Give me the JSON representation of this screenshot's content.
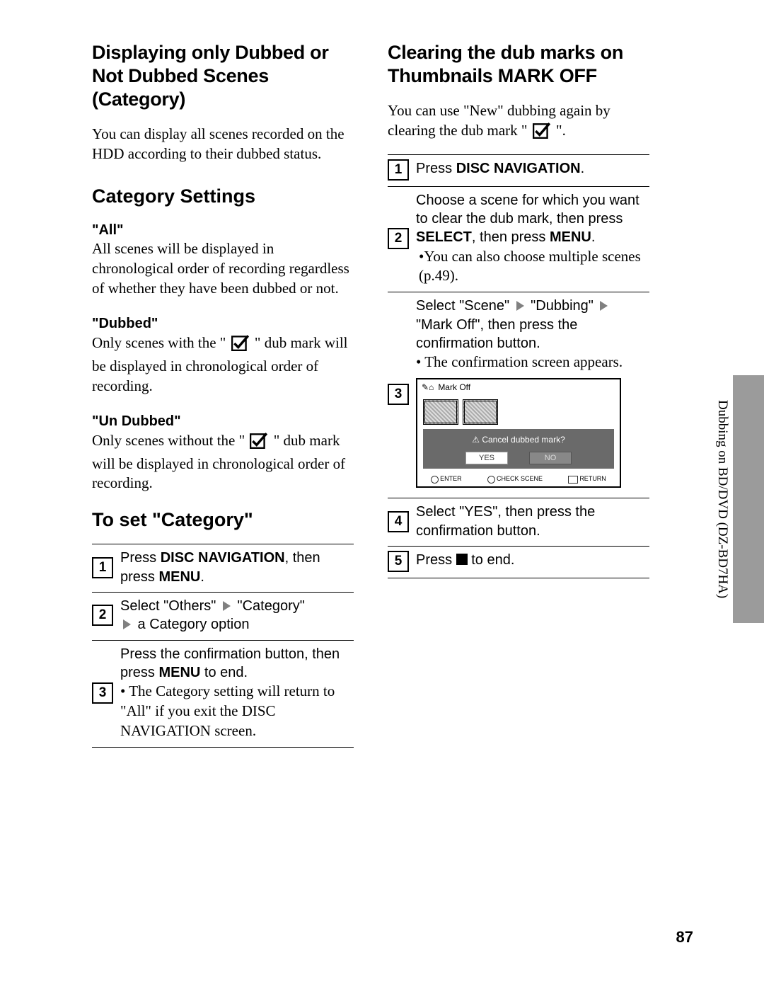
{
  "left": {
    "title": "Displaying only Dubbed or Not Dubbed Scenes (Category)",
    "intro": "You can display all scenes recorded on the HDD according to their dubbed status.",
    "h_category": "Category Settings",
    "cat_all_label": "\"All\"",
    "cat_all_body": "All scenes will be displayed in chronological order of recording regardless of whether they have been dubbed or not.",
    "cat_dubbed_label": "\"Dubbed\"",
    "cat_dubbed_pre": "Only scenes with the \" ",
    "cat_dubbed_post": " \" dub mark will be displayed in chronological order of recording.",
    "cat_undub_label": "\"Un Dubbed\"",
    "cat_undub_pre": "Only scenes without the \" ",
    "cat_undub_post": " \" dub mark will be displayed in chronological order of recording.",
    "h_toset": "To set \"Category\"",
    "s1_a": "Press ",
    "s1_b": "DISC NAVIGATION",
    "s1_c": ", then press ",
    "s1_d": "MENU",
    "s1_e": ".",
    "s2_a": "Select \"Others\" ",
    "s2_b": " \"Category\" ",
    "s2_c": " a Category option",
    "s3_a": "Press the confirmation button, then press ",
    "s3_b": "MENU",
    "s3_c": " to end.",
    "s3_note": "The Category setting will return to \"All\" if you exit the DISC NAVIGATION screen."
  },
  "right": {
    "title": "Clearing the dub marks on Thumbnails MARK OFF",
    "intro_a": "You can use \"New\" dubbing again by clearing the dub mark \" ",
    "intro_b": " \".",
    "r1_a": "Press ",
    "r1_b": "DISC NAVIGATION",
    "r1_c": ".",
    "r2_a": "Choose a scene for which you want to clear the dub mark, then press ",
    "r2_b": "SELECT",
    "r2_c": ", then press ",
    "r2_d": "MENU",
    "r2_e": ".",
    "r2_note": "You can also choose multiple scenes (p.49).",
    "r3_a": "Select \"Scene\" ",
    "r3_b": " \"Dubbing\" ",
    "r3_c": " \"Mark Off\", then press the confirmation button.",
    "r3_note": "The confirmation screen appears.",
    "screen_title": "Mark  Off",
    "screen_msg": "Cancel dubbed mark?",
    "screen_yes": "YES",
    "screen_no": "NO",
    "screen_f1": "ENTER",
    "screen_f2": "CHECK  SCENE",
    "screen_f3": "RETURN",
    "r4": "Select \"YES\", then press the confirmation button.",
    "r5_a": "Press ",
    "r5_b": " to end."
  },
  "side_text": "Dubbing on BD/DVD (DZ-BD7HA)",
  "page_number": "87"
}
